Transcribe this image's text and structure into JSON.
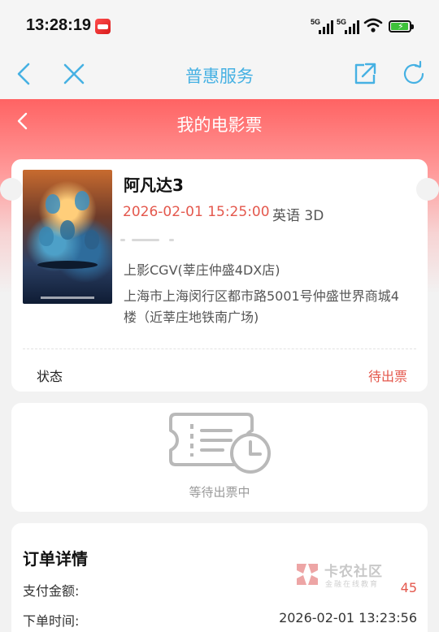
{
  "status_bar": {
    "time": "13:28:19",
    "signal_1": "5G",
    "signal_2": "5G"
  },
  "nav": {
    "title": "普惠服务"
  },
  "hero": {
    "title": "我的电影票"
  },
  "ticket": {
    "movie_title": "阿凡达3",
    "show_time": "2026-02-01 15:25:00",
    "language_format": "英语 3D",
    "cinema_name": "上影CGV(莘庄仲盛4DX店)",
    "cinema_address": "上海市上海闵行区都市路5001号仲盛世界商城4楼（近莘庄地铁南广场)",
    "status_label": "状态",
    "status_value": "待出票"
  },
  "waiting": {
    "text": "等待出票中"
  },
  "order": {
    "title": "订单详情",
    "pay_label": "支付金额:",
    "pay_value": "45",
    "time_label": "下单时间:",
    "time_value": "2026-02-01 13:23:56"
  },
  "watermark": {
    "name": "卡农社区",
    "sub": "金融在线教育"
  },
  "colors": {
    "accent_blue": "#46b1e3",
    "accent_red": "#e4584d",
    "hero_red": "#ff6363"
  },
  "icons": {
    "nav_back": "chevron-left-icon",
    "nav_close": "close-icon",
    "nav_share": "share-icon",
    "nav_refresh": "refresh-icon",
    "hero_back": "chevron-left-icon",
    "waiting": "ticket-clock-icon"
  }
}
